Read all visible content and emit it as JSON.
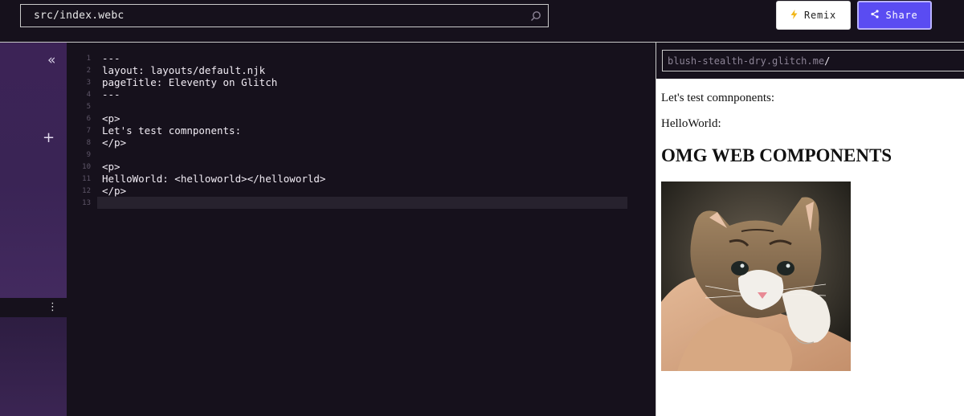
{
  "header": {
    "file_path": "src/index.webc",
    "remix_label": "Remix",
    "share_label": "Share",
    "colors": {
      "share_bg": "#5a4cf2",
      "remix_bg": "#ffffff",
      "background": "#16111c"
    }
  },
  "sidebar": {
    "collapse_icon": "double-chevron-left-icon",
    "add_icon": "plus-icon",
    "menu_icon": "kebab-icon"
  },
  "editor": {
    "lines": [
      {
        "num": "1",
        "text": "---"
      },
      {
        "num": "2",
        "text": "layout: layouts/default.njk"
      },
      {
        "num": "3",
        "text": "pageTitle: Eleventy on Glitch"
      },
      {
        "num": "4",
        "text": "---"
      },
      {
        "num": "5",
        "text": ""
      },
      {
        "num": "6",
        "text": "<p>"
      },
      {
        "num": "7",
        "text": "Let's test comnponents:"
      },
      {
        "num": "8",
        "text": "</p>"
      },
      {
        "num": "9",
        "text": ""
      },
      {
        "num": "10",
        "text": "<p>"
      },
      {
        "num": "11",
        "text": "HelloWorld: <helloworld></helloworld>"
      },
      {
        "num": "12",
        "text": "</p>"
      },
      {
        "num": "13",
        "text": ""
      }
    ]
  },
  "preview": {
    "url_host": "blush-stealth-dry.glitch.me",
    "url_path": "/",
    "paragraph1": "Let's test comnponents:",
    "paragraph2": "HelloWorld:",
    "heading": "OMG WEB COMPONENTS",
    "image": "kitten-photo"
  }
}
